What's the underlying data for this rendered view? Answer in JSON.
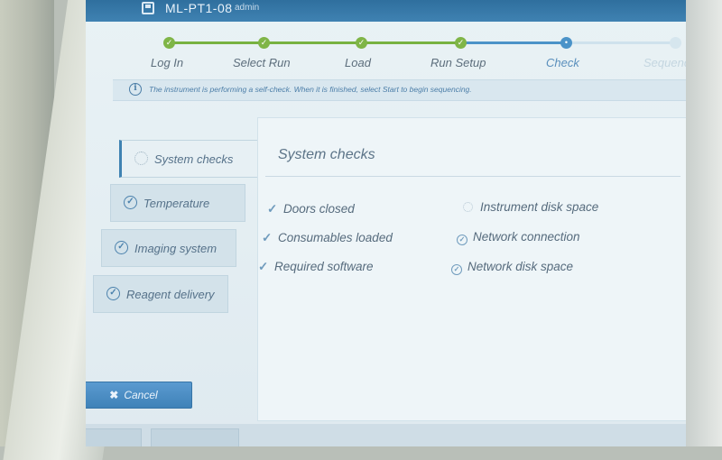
{
  "header": {
    "device_name": "ML-PT1-08",
    "user": "admin"
  },
  "stepper": {
    "steps": [
      {
        "label": "Log In",
        "state": "done"
      },
      {
        "label": "Select Run",
        "state": "done"
      },
      {
        "label": "Load",
        "state": "done"
      },
      {
        "label": "Run Setup",
        "state": "done"
      },
      {
        "label": "Check",
        "state": "current"
      },
      {
        "label": "Sequence",
        "state": "future"
      }
    ]
  },
  "info": {
    "message": "The instrument is performing a self-check. When it is finished, select Start to begin sequencing."
  },
  "sidebar": {
    "items": [
      {
        "label": "System checks",
        "status": "in-progress"
      },
      {
        "label": "Temperature",
        "status": "complete"
      },
      {
        "label": "Imaging system",
        "status": "complete"
      },
      {
        "label": "Reagent delivery",
        "status": "complete"
      }
    ]
  },
  "main": {
    "title": "System checks",
    "checks": [
      {
        "label": "Doors closed",
        "status": "passed"
      },
      {
        "label": "Consumables loaded",
        "status": "passed"
      },
      {
        "label": "Required software",
        "status": "passed"
      },
      {
        "label": "Instrument disk space",
        "status": "pending"
      },
      {
        "label": "Network connection",
        "status": "passed"
      },
      {
        "label": "Network disk space",
        "status": "passed"
      }
    ]
  },
  "actions": {
    "cancel_label": "Cancel"
  },
  "colors": {
    "accent": "#3f82b2",
    "complete": "#7fb547"
  }
}
